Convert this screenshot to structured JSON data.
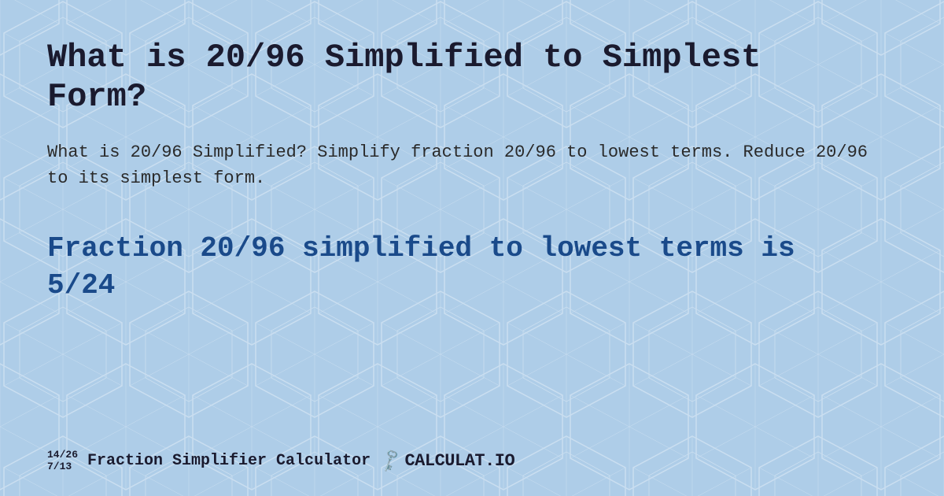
{
  "page": {
    "title": "What is 20/96 Simplified to Simplest Form?",
    "description": "What is 20/96 Simplified? Simplify fraction 20/96 to lowest terms. Reduce 20/96 to its simplest form.",
    "result": "Fraction 20/96 simplified to lowest terms is 5/24",
    "background_color": "#aecde8"
  },
  "footer": {
    "fraction1": "14/26",
    "fraction2": "7/13",
    "brand_label": "Fraction Simplifier Calculator",
    "logo_text": "CALCULAT.IO",
    "key_icon": "🗝"
  }
}
